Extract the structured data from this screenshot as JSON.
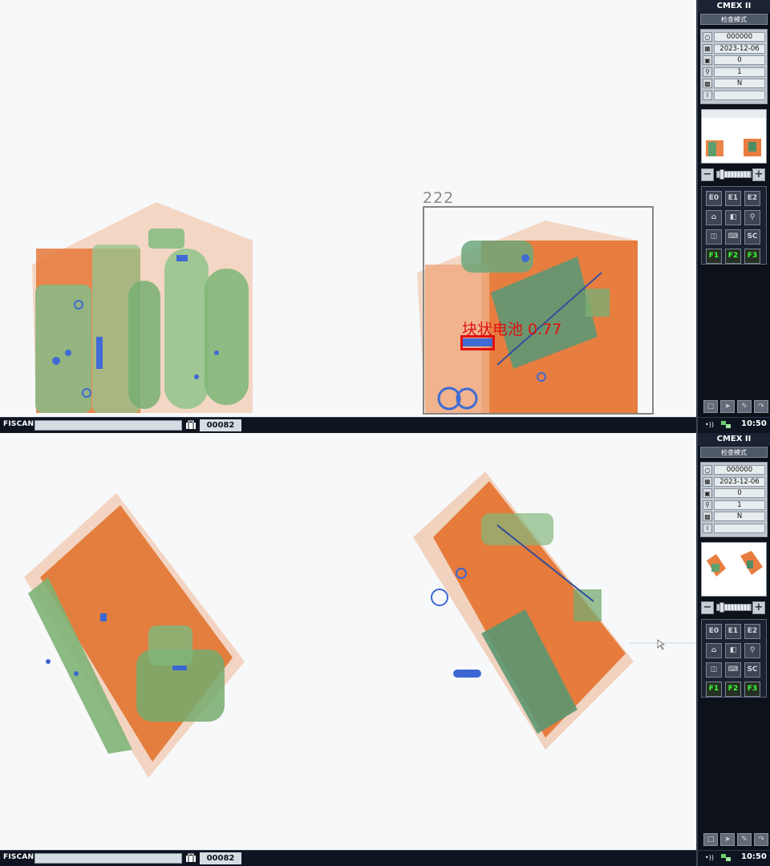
{
  "app": {
    "title": "CMEX II",
    "mode": "检查模式",
    "brand": "FISCAN"
  },
  "info": {
    "operator": "000000",
    "date": "2023-12-06",
    "counter": "0",
    "zoom": "1",
    "flag": "N",
    "extra": ""
  },
  "status": {
    "bag_count": "00082",
    "time": "10:50"
  },
  "detection": {
    "box_id": "222",
    "threat_label": "块状电池 0.77"
  },
  "buttons": {
    "e0": "E0",
    "e1": "E1",
    "e2": "E2",
    "sc": "SC",
    "f1": "F1",
    "f2": "F2",
    "f3": "F3"
  },
  "icons": [
    "user-icon",
    "calendar-icon",
    "counter-icon",
    "magnifier-icon",
    "bag-icon",
    "info-icon",
    "home-icon",
    "split-view-icon",
    "zoom-icon",
    "book-icon",
    "keyboard-icon"
  ],
  "colors": {
    "organic": "#e06a1e",
    "inorganic": "#4d9a49",
    "metal": "#2a52c9",
    "threat": "#e01010",
    "panel": "#0d1119"
  }
}
